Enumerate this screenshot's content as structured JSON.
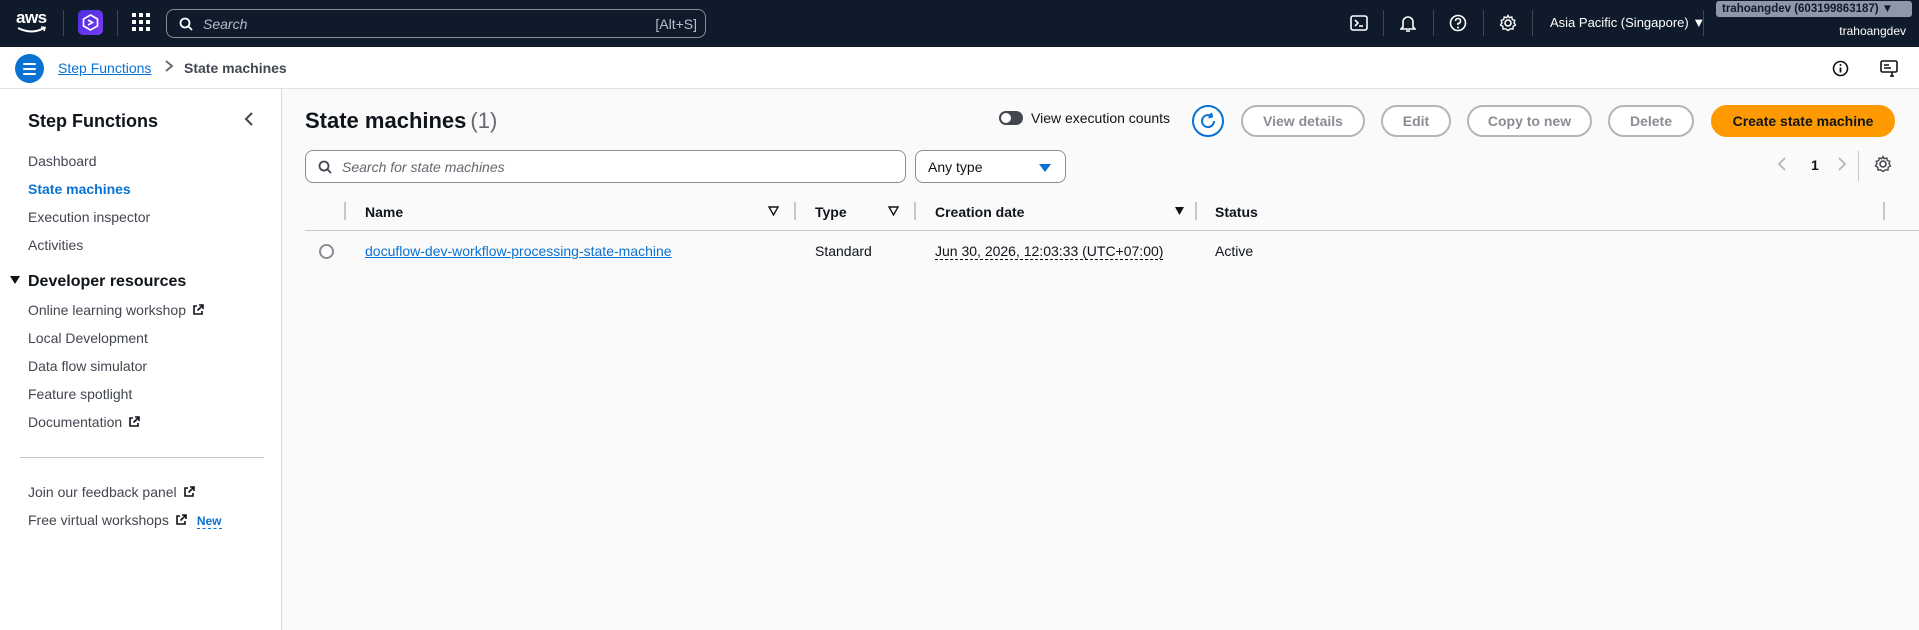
{
  "topnav": {
    "logo_text": "aws",
    "search_placeholder": "Search",
    "search_shortcut": "[Alt+S]",
    "region": "Asia Pacific (Singapore) ▼",
    "account_id_label": "trahoangdev (603199863187) ▼",
    "account_user": "trahoangdev",
    "icons": [
      "cloudshell-icon",
      "bell-icon",
      "help-icon",
      "gear-icon"
    ]
  },
  "breadcrumb": {
    "parent": "Step Functions",
    "separator": ">",
    "current": "State machines"
  },
  "sidenav": {
    "title": "Step Functions",
    "items": [
      "Dashboard",
      "State machines",
      "Execution inspector",
      "Activities"
    ],
    "active_item": "State machines",
    "section_title": "Developer resources",
    "section_items": [
      {
        "label": "Online learning workshop",
        "external": true
      },
      {
        "label": "Local Development",
        "external": false
      },
      {
        "label": "Data flow simulator",
        "external": false
      },
      {
        "label": "Feature spotlight",
        "external": false
      },
      {
        "label": "Documentation",
        "external": true
      }
    ],
    "footer_items": [
      {
        "label": "Join our feedback panel",
        "external": true
      },
      {
        "label": "Free virtual workshops",
        "external": true,
        "badge": "New"
      }
    ]
  },
  "main": {
    "title": "State machines",
    "count": "(1)",
    "toggle_label": "View execution counts",
    "buttons": {
      "view_details": "View details",
      "edit": "Edit",
      "copy_to_new": "Copy to new",
      "delete": "Delete",
      "create": "Create state machine"
    },
    "search_placeholder": "Search for state machines",
    "type_filter": "Any type",
    "page": "1"
  },
  "table": {
    "columns": [
      "Name",
      "Type",
      "Creation date",
      "Status"
    ],
    "rows": [
      {
        "name": "docuflow-dev-workflow-processing-state-machine",
        "type": "Standard",
        "creation_date": "Jun 30, 2026, 12:03:33 (UTC+07:00)",
        "status": "Active"
      }
    ]
  },
  "colors": {
    "topnav_bg": "#0f1b2a",
    "link_blue": "#0972d3",
    "primary_orange": "#ff9900"
  }
}
